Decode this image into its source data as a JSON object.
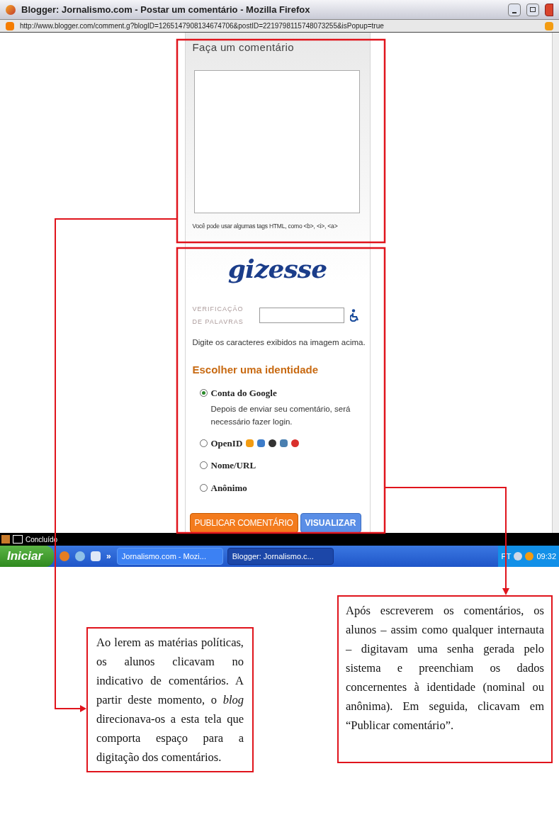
{
  "window": {
    "title": "Blogger: Jornalismo.com - Postar um comentário - Mozilla Firefox"
  },
  "address_bar": {
    "url": "http://www.blogger.com/comment.g?blogID=1265147908134674706&postID=2219798115748073255&isPopup=true"
  },
  "comment_form": {
    "heading": "Faça um comentário",
    "hint": "Você pode usar algumas tags HTML, como <b>, <i>, <a>"
  },
  "verification": {
    "captcha_word": "gizesse",
    "label": "VERIFICAÇÃO DE PALAVRAS",
    "instruction": "Digite os caracteres exibidos na imagem acima."
  },
  "identity": {
    "heading": "Escolher uma identidade",
    "options": [
      {
        "label": "Conta do Google",
        "selected": true,
        "kind": "note",
        "note": "Depois de enviar seu comentário, será necessário fazer login."
      },
      {
        "label": "OpenID",
        "selected": false,
        "kind": "icons"
      },
      {
        "label": "Nome/URL",
        "selected": false,
        "kind": "plain"
      },
      {
        "label": "Anônimo",
        "selected": false,
        "kind": "plain"
      }
    ]
  },
  "buttons": [
    {
      "label": "PUBLICAR COMENTÁRIO",
      "kind": "primary"
    },
    {
      "label": "VISUALIZAR",
      "kind": "secondary"
    }
  ],
  "status_bar": {
    "text": "Concluído"
  },
  "taskbar": {
    "start": "Iniciar",
    "chevron": "»",
    "tasks": [
      {
        "label": "Jornalismo.com - Mozi...",
        "selected": false
      },
      {
        "label": "Blogger: Jornalismo.c...",
        "selected": true
      }
    ],
    "language": "PT",
    "clock": "09:32"
  },
  "annotations": [
    {
      "text": "Ao lerem as matérias políticas, os alunos clicavam no indicativo de comentários. A partir deste momento, o *blog* direcionava-os a esta tela que comporta espaço para a digitação dos comentários."
    },
    {
      "text": "Após escreverem os comentários, os alunos – assim como qualquer internauta – digitavam uma senha gerada pelo sistema e preenchiam os dados concernentes à identidade (nominal ou anônima). Em seguida, clicavam em “Publicar comentário”."
    }
  ]
}
